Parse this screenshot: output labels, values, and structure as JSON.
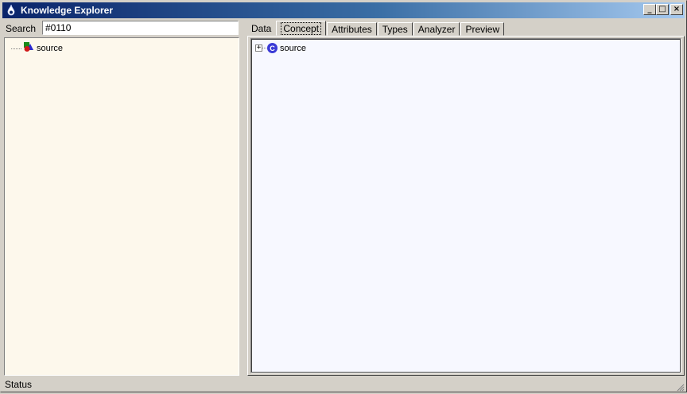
{
  "window": {
    "title": "Knowledge Explorer",
    "controls": {
      "minimize": "_",
      "maximize": "□",
      "close": "×"
    }
  },
  "search": {
    "label": "Search",
    "value": "#0110"
  },
  "left_tree": {
    "items": [
      {
        "label": "source",
        "icon": "source-shapes-icon"
      }
    ]
  },
  "tabs": [
    {
      "label": "Data"
    },
    {
      "label": "Concept",
      "active": true
    },
    {
      "label": "Attributes"
    },
    {
      "label": "Types"
    },
    {
      "label": "Analyzer"
    },
    {
      "label": "Preview"
    }
  ],
  "concept_tree": {
    "items": [
      {
        "label": "source",
        "icon": "concept-icon",
        "icon_letter": "C",
        "expander": "+"
      }
    ]
  },
  "status": {
    "text": "Status"
  },
  "colors": {
    "titlebar_start": "#0a246a",
    "titlebar_end": "#a6caf0",
    "left_tree_bg": "#fdf8ec",
    "right_tree_bg": "#f7f8ff",
    "concept_icon": "#3b3bd6"
  }
}
